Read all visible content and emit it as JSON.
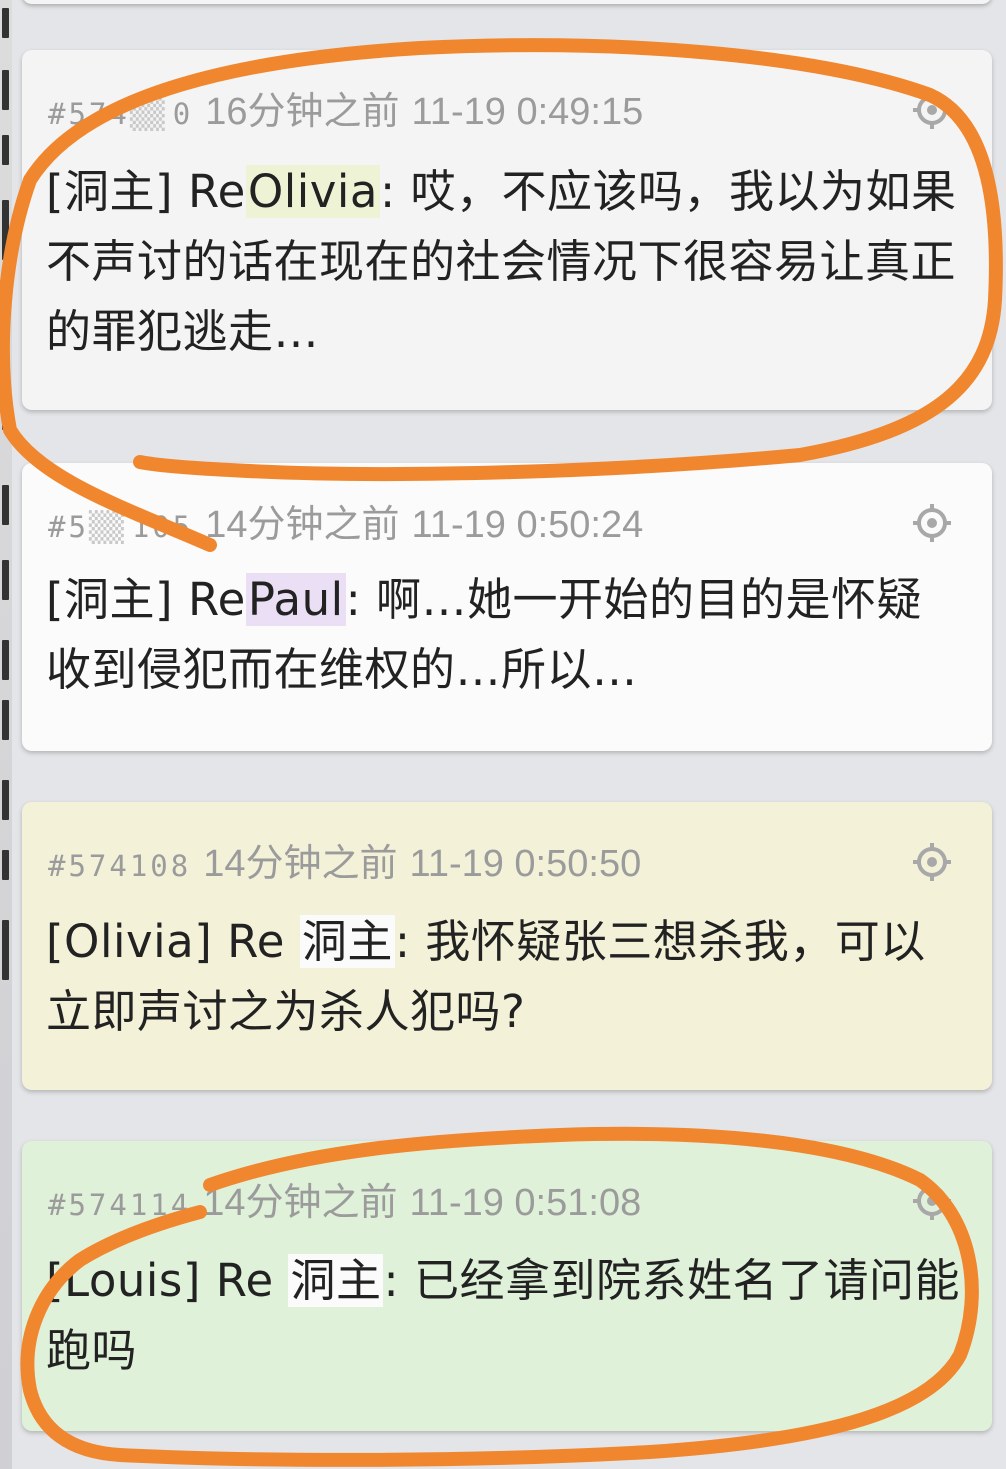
{
  "posts": [
    {
      "id": "#5740?0",
      "id_visible": "#574",
      "id_tail": "0",
      "relative_time": "16分钟之前",
      "timestamp": "11-19 0:49:15",
      "author": "[洞主]",
      "re_label": "Re",
      "mention": "Olivia",
      "body": ": 哎，不应该吗，我以为如果不声讨的话在现在的社会情况下很容易让真正的罪犯逃走…",
      "bg": "#f4f4f4"
    },
    {
      "id": "#5?4105",
      "id_visible": "#5",
      "id_tail": "105",
      "relative_time": "14分钟之前",
      "timestamp": "11-19 0:50:24",
      "author": "[洞主]",
      "re_label": "Re",
      "mention": "Paul",
      "body": ": 啊…她一开始的目的是怀疑收到侵犯而在维权的…所以…",
      "bg": "#fbfbfb"
    },
    {
      "id": "#574108",
      "relative_time": "14分钟之前",
      "timestamp": "11-19 0:50:50",
      "author": "[Olivia]",
      "re_label": "Re",
      "mention": "洞主",
      "body": ": 我怀疑张三想杀我，可以立即声讨之为杀人犯吗?",
      "bg": "#f3f2d9"
    },
    {
      "id": "#574114",
      "relative_time": "14分钟之前",
      "timestamp": "11-19 0:51:08",
      "author": "[Louis]",
      "re_label": "Re",
      "mention": "洞主",
      "body": ": 已经拿到院系姓名了请问能跑吗",
      "bg": "#e0f1da"
    }
  ],
  "annotation_color": "#f0872f"
}
